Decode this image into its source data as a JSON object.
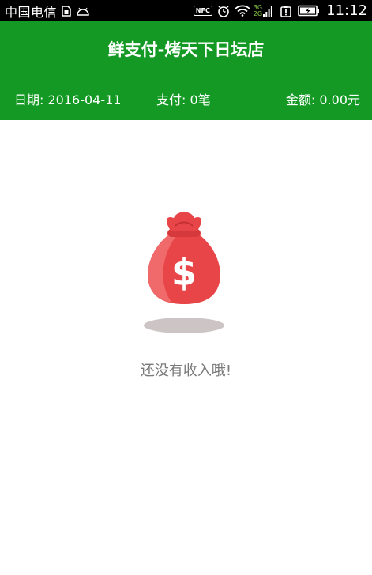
{
  "status_bar": {
    "carrier": "中国电信",
    "nfc_label": "NFC",
    "network_top": "3G",
    "network_bottom": "2G",
    "time": "11:12"
  },
  "header": {
    "title": "鲜支付-烤天下日坛店",
    "date_text": "日期: 2016-04-11",
    "payments_text": "支付: 0笔",
    "amount_text": "金额: 0.00元"
  },
  "empty_state": {
    "icon": "money-bag-icon",
    "currency_symbol": "$",
    "message": "还没有收入哦!"
  },
  "colors": {
    "header_green": "#149a24",
    "bag_red": "#e84548",
    "message_gray": "#7a7a7a"
  }
}
